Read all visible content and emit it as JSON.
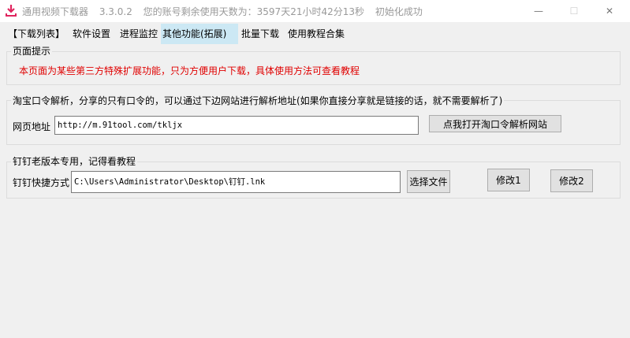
{
  "window": {
    "title": "通用视频下载器",
    "version": "3.3.0.2",
    "remaining": "您的账号剩余使用天数为：3597天21小时42分13秒",
    "status": "初始化成功",
    "controls": {
      "min": "—",
      "max": "☐",
      "close": "✕"
    }
  },
  "tabs": [
    {
      "label": "【下载列表】"
    },
    {
      "label": "软件设置"
    },
    {
      "label": "进程监控"
    },
    {
      "label": "其他功能(拓展)"
    },
    {
      "label": "批量下载"
    },
    {
      "label": "使用教程合集"
    }
  ],
  "notice_group": {
    "title": "页面提示",
    "text": "本页面为某些第三方特殊扩展功能，只为方便用户下载，具体使用方法可查看教程"
  },
  "taobao_group": {
    "title": "淘宝口令解析，分享的只有口令的，可以通过下边网站进行解析地址(如果你直接分享就是链接的话，就不需要解析了)",
    "url_label": "网页地址",
    "url_value": "http://m.91tool.com/tkljx",
    "open_button": "点我打开淘口令解析网站"
  },
  "dingtalk_group": {
    "title": "钉钉老版本专用，记得看教程",
    "shortcut_label": "钉钉快捷方式",
    "shortcut_value": "C:\\Users\\Administrator\\Desktop\\钉钉.lnk",
    "choose_button": "选择文件",
    "modify1_button": "修改1",
    "modify2_button": "修改2"
  },
  "colors": {
    "notice": "#e00000",
    "active_tab": "#cce8f4",
    "icon": "#e0245e"
  }
}
